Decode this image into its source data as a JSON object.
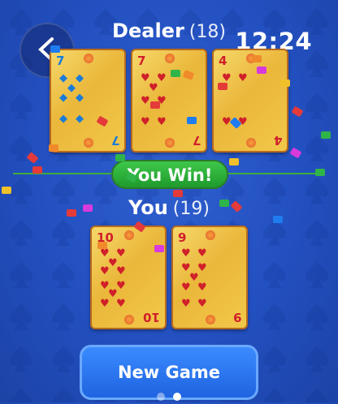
{
  "header": {
    "dealer_label": "Dealer",
    "dealer_score": "(18)",
    "clock": "12:24"
  },
  "player": {
    "label": "You",
    "score": "(19)"
  },
  "result": "You Win!",
  "new_game_label": "New Game",
  "icons": {
    "back": "chevron-left-icon"
  },
  "dealer_cards": [
    {
      "rank": "7",
      "suit": "diamonds",
      "color": "blue"
    },
    {
      "rank": "7",
      "suit": "hearts",
      "color": "red"
    },
    {
      "rank": "4",
      "suit": "hearts",
      "color": "red"
    }
  ],
  "player_cards": [
    {
      "rank": "10",
      "suit": "hearts",
      "color": "red"
    },
    {
      "rank": "9",
      "suit": "hearts",
      "color": "red"
    }
  ],
  "page_indicator": {
    "count": 2,
    "active": 2
  },
  "colors": {
    "background": "#2350c0",
    "win_badge": "#2aa83a",
    "button": "#2a72ee",
    "card": "#f2c84a"
  }
}
